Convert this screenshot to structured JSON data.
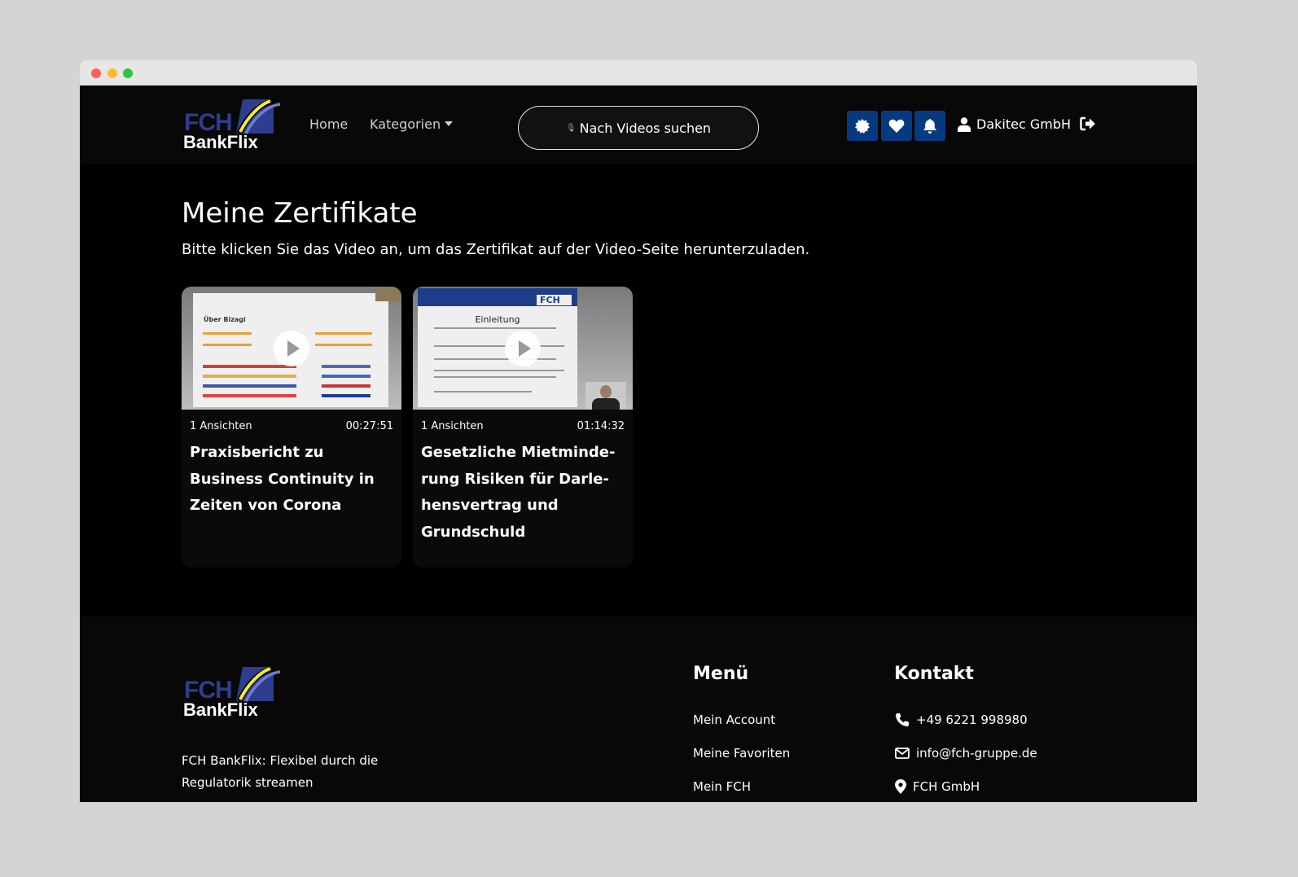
{
  "header": {
    "logo_top": "FCH",
    "logo_bottom": "BankFlix",
    "nav": [
      {
        "label": "Home"
      },
      {
        "label": "Kategorien"
      }
    ],
    "search_label": "Nach Videos suchen",
    "icons": [
      "certificate-icon",
      "heart-icon",
      "bell-icon"
    ],
    "user_name": "Dakitec GmbH",
    "accent_color": "#063a80"
  },
  "main": {
    "title": "Meine Zertifikate",
    "subtitle": "Bitte klicken Sie das Video an, um das Zertifikat auf der Video-Seite herunterzuladen.",
    "videos": [
      {
        "views": "1 Ansichten",
        "duration": "00:27:51",
        "title": "Praxisbericht zu Business Continuity in Zeiten von Corona",
        "slide_heading": "Über Bizagi"
      },
      {
        "views": "1 Ansichten",
        "duration": "01:14:32",
        "title": "Gesetzliche Mietminde­rung Risiken für Darle­hensvertrag und Grundschuld",
        "slide_heading": "Einleitung"
      }
    ]
  },
  "footer": {
    "logo_top": "FCH",
    "logo_bottom": "BankFlix",
    "tagline": "FCH BankFlix: Flexibel durch die Regulatorik streamen",
    "menu_heading": "Menü",
    "menu_items": [
      {
        "label": "Mein Account"
      },
      {
        "label": "Meine Favoriten"
      },
      {
        "label": "Mein FCH"
      }
    ],
    "contact_heading": "Kontakt",
    "contact": {
      "phone": "+49 6221 998980",
      "email": "info@fch-gruppe.de",
      "address": "FCH GmbH"
    }
  }
}
